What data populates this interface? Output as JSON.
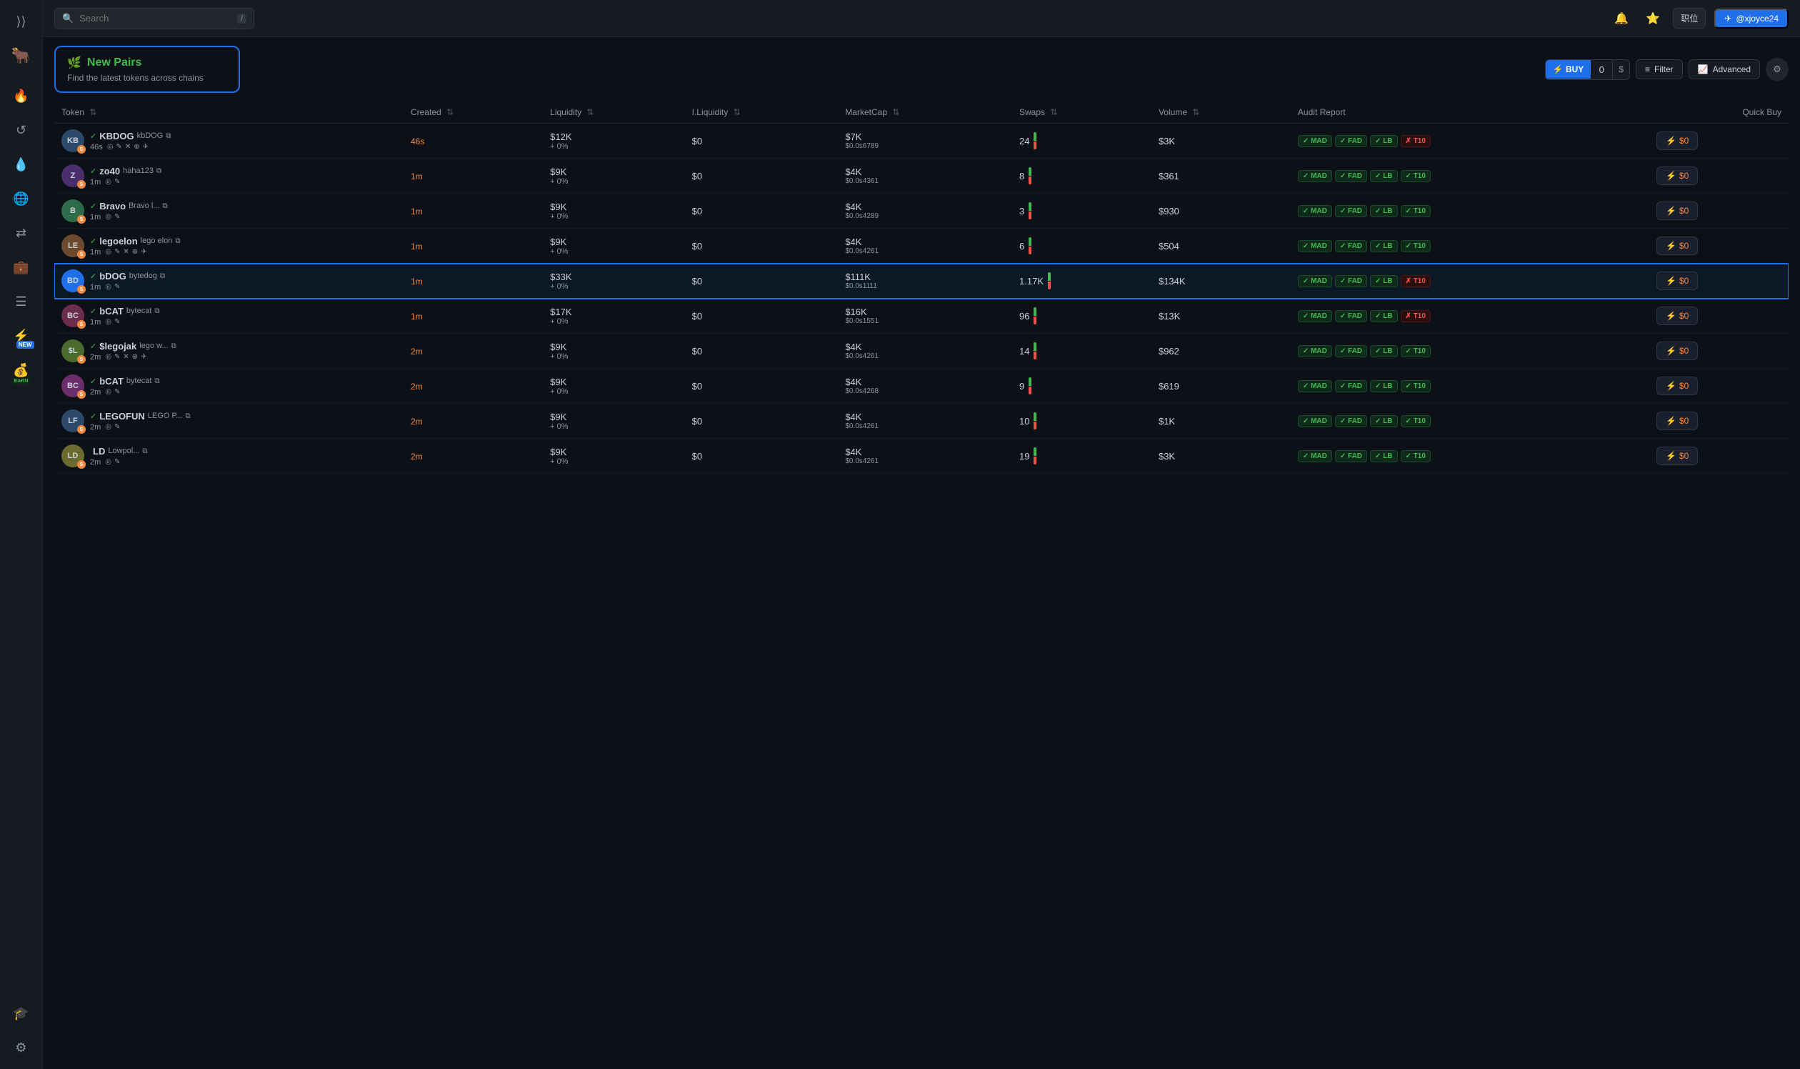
{
  "sidebar": {
    "icons": [
      {
        "name": "expand-icon",
        "symbol": "⟩⟩",
        "active": false
      },
      {
        "name": "bull-logo-icon",
        "symbol": "🐂",
        "active": false
      },
      {
        "name": "flame-icon",
        "symbol": "🔥",
        "active": false
      },
      {
        "name": "history-icon",
        "symbol": "↺",
        "active": false
      },
      {
        "name": "drop-icon",
        "symbol": "💧",
        "active": false
      },
      {
        "name": "globe-icon",
        "symbol": "🌐",
        "active": false
      },
      {
        "name": "swap-icon",
        "symbol": "⇄",
        "active": false
      },
      {
        "name": "wallet-icon",
        "symbol": "💼",
        "active": false
      },
      {
        "name": "list-icon",
        "symbol": "☰",
        "active": false
      },
      {
        "name": "new-icon",
        "symbol": "⚡",
        "active": true,
        "badge": "NEW"
      },
      {
        "name": "earn-icon",
        "symbol": "💰",
        "active": false,
        "badge": "EARN"
      },
      {
        "name": "learn-icon",
        "symbol": "🎓",
        "active": false
      },
      {
        "name": "settings-icon",
        "symbol": "⚙",
        "active": false
      }
    ]
  },
  "topbar": {
    "search_placeholder": "Search",
    "shortcut": "/",
    "lang_label": "职位",
    "user_label": "@xjoyce24"
  },
  "header": {
    "new_pairs_title": "New Pairs",
    "new_pairs_icon": "🌿",
    "new_pairs_subtitle": "Find the latest tokens across chains",
    "buy_label": "⚡ BUY",
    "buy_value": "0",
    "buy_currency": "$",
    "filter_label": "Filter",
    "advanced_label": "Advanced"
  },
  "table": {
    "columns": [
      "Token",
      "Created",
      "Liquidity",
      "I.Liquidity",
      "MarketCap",
      "Swaps",
      "Volume",
      "Audit Report",
      "Quick Buy"
    ],
    "rows": [
      {
        "id": "kbdog",
        "avatar_text": "KB",
        "avatar_color": "#2d4a6b",
        "ticker": "KBDOG",
        "fullname": "kbDOG",
        "verified": true,
        "time": "46s",
        "created": "46s",
        "liquidity": "$12K",
        "liq_change": "+ 0%",
        "iliquidity": "$0",
        "marketcap": "$7K",
        "mc_sub": "$0.0s6789",
        "swaps": "24",
        "volume": "$3K",
        "audit": [
          "MAD",
          "FAD",
          "LB",
          "!T10"
        ],
        "quickbuy": "$0",
        "highlighted": false
      },
      {
        "id": "zo40",
        "avatar_text": "Z",
        "avatar_color": "#4a2d6b",
        "ticker": "zo40",
        "fullname": "haha123",
        "verified": true,
        "time": "1m",
        "created": "1m",
        "liquidity": "$9K",
        "liq_change": "+ 0%",
        "iliquidity": "$0",
        "marketcap": "$4K",
        "mc_sub": "$0.0s4361",
        "swaps": "8",
        "volume": "$361",
        "audit": [
          "MAD",
          "FAD",
          "LB",
          "T10"
        ],
        "quickbuy": "$0",
        "highlighted": false
      },
      {
        "id": "bravo",
        "avatar_text": "B",
        "avatar_color": "#2d6b4a",
        "ticker": "Bravo",
        "fullname": "Bravo l...",
        "verified": true,
        "time": "1m",
        "created": "1m",
        "liquidity": "$9K",
        "liq_change": "+ 0%",
        "iliquidity": "$0",
        "marketcap": "$4K",
        "mc_sub": "$0.0s4289",
        "swaps": "3",
        "volume": "$930",
        "audit": [
          "MAD",
          "FAD",
          "LB",
          "T10"
        ],
        "quickbuy": "$0",
        "highlighted": false
      },
      {
        "id": "legoelon",
        "avatar_text": "LE",
        "avatar_color": "#6b4a2d",
        "ticker": "legoelon",
        "fullname": "lego elon",
        "verified": true,
        "time": "1m",
        "created": "1m",
        "liquidity": "$9K",
        "liq_change": "+ 0%",
        "iliquidity": "$0",
        "marketcap": "$4K",
        "mc_sub": "$0.0s4261",
        "swaps": "6",
        "volume": "$504",
        "audit": [
          "MAD",
          "FAD",
          "LB",
          "T10"
        ],
        "quickbuy": "$0",
        "highlighted": false
      },
      {
        "id": "bdog",
        "avatar_text": "BD",
        "avatar_color": "#1f6feb",
        "ticker": "bDOG",
        "fullname": "bytedog",
        "verified": true,
        "time": "1m",
        "created": "1m",
        "liquidity": "$33K",
        "liq_change": "+ 0%",
        "iliquidity": "$0",
        "marketcap": "$111K",
        "mc_sub": "$0.0s1111",
        "swaps": "1.17K",
        "volume": "$134K",
        "audit": [
          "MAD",
          "FAD",
          "LB",
          "!T10"
        ],
        "quickbuy": "$0",
        "highlighted": true
      },
      {
        "id": "bcat",
        "avatar_text": "BC",
        "avatar_color": "#6b2d4a",
        "ticker": "bCAT",
        "fullname": "bytecat",
        "verified": true,
        "time": "1m",
        "created": "1m",
        "liquidity": "$17K",
        "liq_change": "+ 0%",
        "iliquidity": "$0",
        "marketcap": "$16K",
        "mc_sub": "$0.0s1551",
        "swaps": "96",
        "volume": "$13K",
        "audit": [
          "MAD",
          "FAD",
          "LB",
          "!T10"
        ],
        "quickbuy": "$0",
        "highlighted": false
      },
      {
        "id": "legojak",
        "avatar_text": "$L",
        "avatar_color": "#4a6b2d",
        "ticker": "$legojak",
        "fullname": "lego w...",
        "verified": true,
        "time": "2m",
        "created": "2m",
        "liquidity": "$9K",
        "liq_change": "+ 0%",
        "iliquidity": "$0",
        "marketcap": "$4K",
        "mc_sub": "$0.0s4261",
        "swaps": "14",
        "volume": "$962",
        "audit": [
          "MAD",
          "FAD",
          "LB",
          "T10"
        ],
        "quickbuy": "$0",
        "highlighted": false
      },
      {
        "id": "bcat2",
        "avatar_text": "BC",
        "avatar_color": "#6b2d6b",
        "ticker": "bCAT",
        "fullname": "bytecat",
        "verified": true,
        "time": "2m",
        "created": "2m",
        "liquidity": "$9K",
        "liq_change": "+ 0%",
        "iliquidity": "$0",
        "marketcap": "$4K",
        "mc_sub": "$0.0s4268",
        "swaps": "9",
        "volume": "$619",
        "audit": [
          "MAD",
          "FAD",
          "LB",
          "T10"
        ],
        "quickbuy": "$0",
        "highlighted": false
      },
      {
        "id": "legofun",
        "avatar_text": "LF",
        "avatar_color": "#2d4a6b",
        "ticker": "LEGOFUN",
        "fullname": "LEGO P...",
        "verified": true,
        "time": "2m",
        "created": "2m",
        "liquidity": "$9K",
        "liq_change": "+ 0%",
        "iliquidity": "$0",
        "marketcap": "$4K",
        "mc_sub": "$0.0s4261",
        "swaps": "10",
        "volume": "$1K",
        "audit": [
          "MAD",
          "FAD",
          "LB",
          "T10"
        ],
        "quickbuy": "$0",
        "highlighted": false
      },
      {
        "id": "ld",
        "avatar_text": "LD",
        "avatar_color": "#6b6b2d",
        "ticker": "LD",
        "fullname": "Lowpol...",
        "verified": false,
        "time": "2m",
        "created": "2m",
        "liquidity": "$9K",
        "liq_change": "+ 0%",
        "iliquidity": "$0",
        "marketcap": "$4K",
        "mc_sub": "$0.0s4261",
        "swaps": "19",
        "volume": "$3K",
        "audit": [
          "MAD",
          "FAD",
          "LB",
          "T10"
        ],
        "quickbuy": "$0",
        "highlighted": false
      }
    ]
  }
}
